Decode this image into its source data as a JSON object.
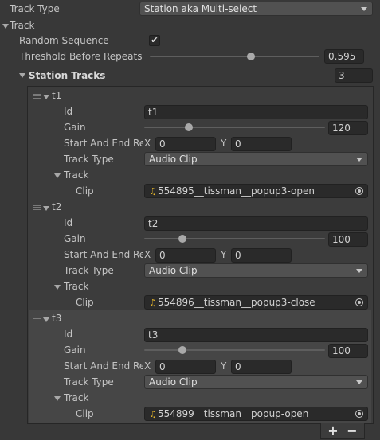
{
  "top": {
    "track_type_label": "Track Type",
    "track_type_value": "Station aka Multi-select",
    "track_section": "Track",
    "random_sequence_label": "Random Sequence",
    "random_sequence_checked": true,
    "threshold_label": "Threshold Before Repeats",
    "threshold_value": "0.595",
    "threshold_level": 0.595,
    "station_tracks_label": "Station Tracks",
    "station_tracks_count": "3"
  },
  "labels": {
    "id": "Id",
    "gain": "Gain",
    "start_end": "Start And End Res",
    "x": "X",
    "y": "Y",
    "track_type": "Track Type",
    "track": "Track",
    "clip": "Clip"
  },
  "tracks": [
    {
      "name": "t1",
      "id": "t1",
      "gain": "120",
      "start_x": "0",
      "end_y": "0",
      "track_type": "Audio Clip",
      "clip": "554895__tissman__popup3-open"
    },
    {
      "name": "t2",
      "id": "t2",
      "gain": "100",
      "start_x": "0",
      "end_y": "0",
      "track_type": "Audio Clip",
      "clip": "554896__tissman__popup3-close"
    },
    {
      "name": "t3",
      "id": "t3",
      "gain": "100",
      "start_x": "0",
      "end_y": "0",
      "track_type": "Audio Clip",
      "clip": "554899__tissman__popup-open"
    }
  ],
  "footer": {
    "add_label": "+",
    "remove_label": "−"
  },
  "icons": {
    "audio_clip": "music-note-icon",
    "object_picker": "target-icon",
    "checkbox": "checkmark-icon",
    "reorder": "drag-handle-icon"
  },
  "colors": {
    "background": "#383838",
    "field": "#2a2a2a",
    "clip_icon": "#e8b82a"
  }
}
